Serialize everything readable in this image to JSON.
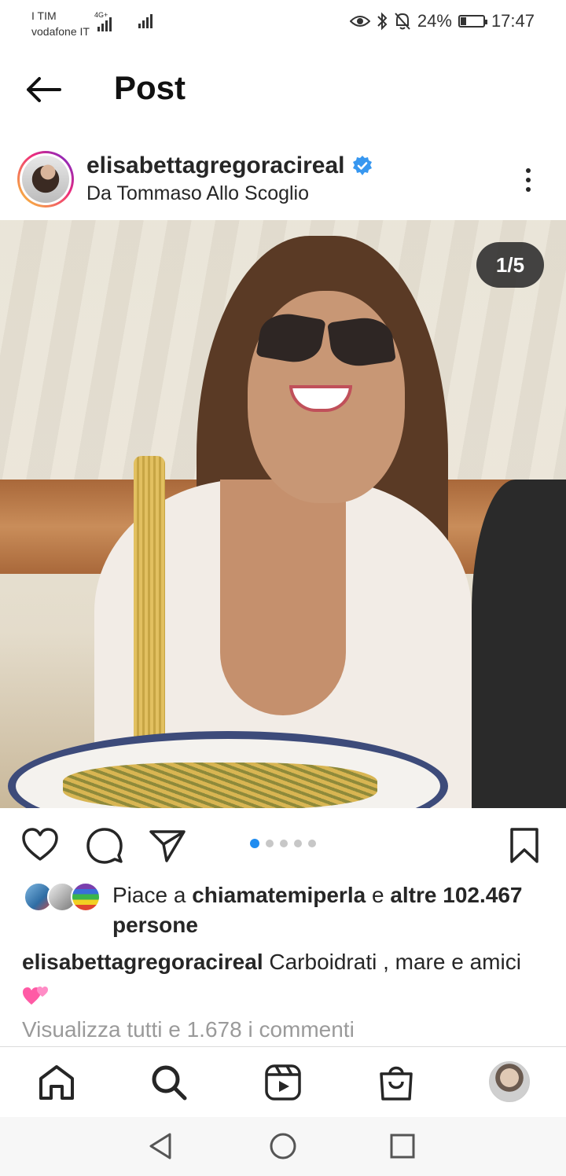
{
  "status_bar": {
    "carrier_1": "I TIM",
    "carrier_2": "vodafone IT",
    "network": "4G+",
    "battery": "24%",
    "battery_level": 0.24,
    "time": "17:47"
  },
  "header": {
    "title": "Post",
    "back_icon": "arrow-left-icon"
  },
  "post": {
    "username": "elisabettagregoracireal",
    "verified": true,
    "location": "Da Tommaso Allo Scoglio",
    "image_counter": "1/5",
    "carousel_total": 5,
    "carousel_active": 1
  },
  "actions": {
    "like_icon": "heart-icon",
    "comment_icon": "comment-icon",
    "share_icon": "send-icon",
    "save_icon": "bookmark-icon"
  },
  "likes": {
    "prefix": "Piace a",
    "user": "chiamatemiperla",
    "conj": "e",
    "others": "altre 102.467 persone"
  },
  "caption": {
    "username": "elisabettagregoracireal",
    "text": "Carboidrati , mare e amici"
  },
  "comments_link": "Visualizza tutti e 1.678 i commenti",
  "bottom_nav": [
    "home-icon",
    "search-icon",
    "reels-icon",
    "shop-icon",
    "profile-avatar"
  ],
  "system_nav": [
    "back-triangle-icon",
    "home-circle-icon",
    "recents-square-icon"
  ],
  "colors": {
    "verified_blue": "#3797f0",
    "dot_active": "#1f8cf0",
    "counter_bg": "#262626"
  }
}
